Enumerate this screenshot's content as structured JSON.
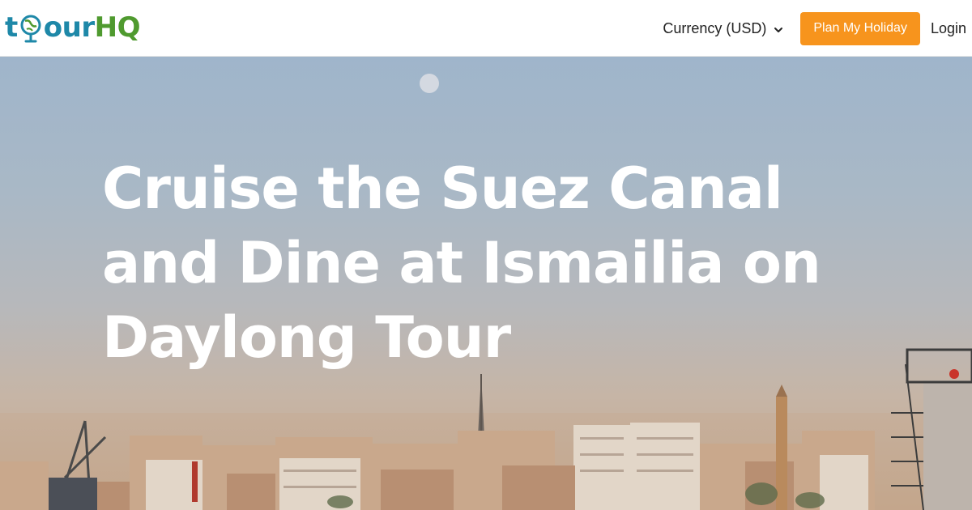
{
  "header": {
    "logo": {
      "text_t": "t",
      "text_our": "our",
      "text_hq": "HQ",
      "color_primary": "#1e88a8",
      "color_accent": "#4f9a2f"
    },
    "currency_label": "Currency (USD)",
    "plan_button_label": "Plan My Holiday",
    "login_label": "Login",
    "accent_color": "#f7941d"
  },
  "hero": {
    "title": "Cruise the Suez Canal and Dine at Ismailia on Daylong Tour"
  },
  "icons": {
    "currency_dropdown": "chevron-down-icon",
    "logo_globe": "globe-icon"
  }
}
